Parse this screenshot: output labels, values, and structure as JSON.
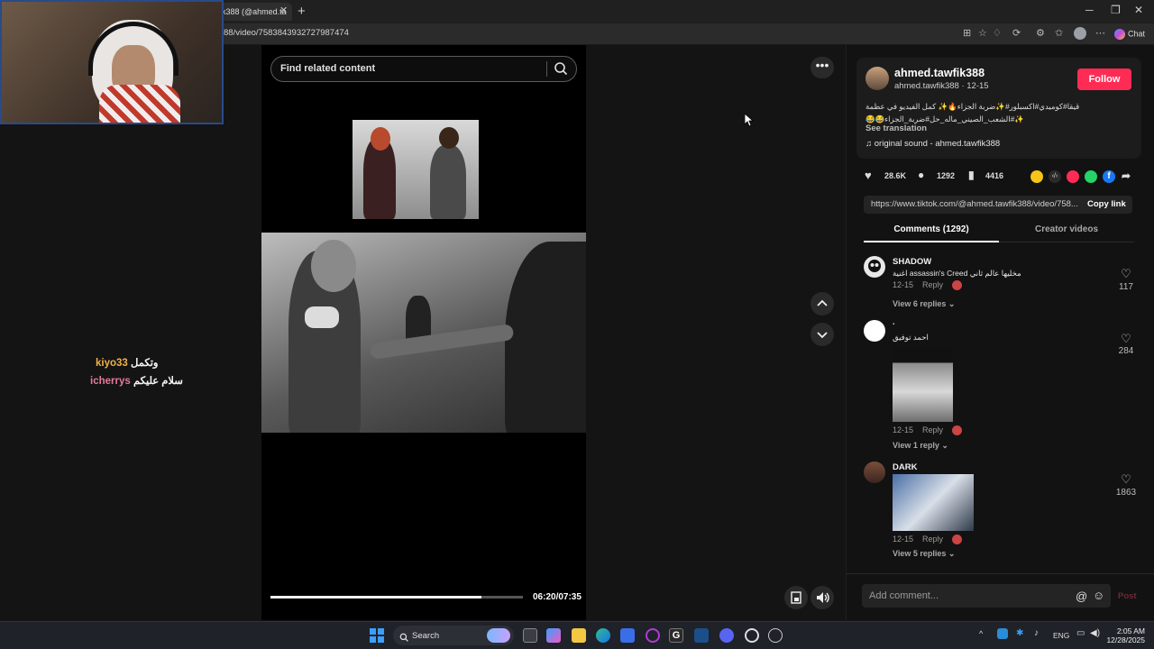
{
  "browser": {
    "tab_title": "k388 (@ahmed.ta",
    "url": "88/video/7583843932727987474",
    "chat_label": "Chat"
  },
  "stream_chat": [
    {
      "user": "kiyo33",
      "message": "وتكمل"
    },
    {
      "user": "icherrys",
      "message": "سلام عليكم"
    }
  ],
  "video": {
    "search_placeholder": "Find related content",
    "time": "06:20/07:35",
    "progress_fraction": 0.836
  },
  "author": {
    "name": "ahmed.tawfik388",
    "sub": "ahmed.tawfik388 · 12-15",
    "follow_label": "Follow",
    "description_line1": "قيقا#كوميدي#اكسبلور#✨ضربة الجزاء🔥✨ كمل الفيديو في عظمة",
    "description_line2": "✨#الشعب_الصيني_ماله_حل#ضربة_الجزاء😂😂",
    "see_translation": "See translation",
    "sound": "original sound - ahmed.tawfik388"
  },
  "stats": {
    "likes": "28.6K",
    "comments": "1292",
    "saves": "4416"
  },
  "share": {
    "link": "https://www.tiktok.com/@ahmed.tawfik388/video/758...",
    "copy_label": "Copy link"
  },
  "tabs": {
    "comments": "Comments (1292)",
    "creator": "Creator videos"
  },
  "comments": [
    {
      "name": "SHADOW",
      "text": "اغنية assassin's Creed مخليها عالم ثاني",
      "date": "12-15",
      "reply": "Reply",
      "likes": "117",
      "view": "View 6 replies ⌄"
    },
    {
      "name": ".",
      "text": "احمد توفيق",
      "date": "12-15",
      "reply": "Reply",
      "likes": "284",
      "view": "View 1 reply ⌄"
    },
    {
      "name": "DARK",
      "text": "",
      "date": "12-15",
      "reply": "Reply",
      "likes": "1863",
      "view": "View 5 replies ⌄"
    }
  ],
  "comment_input": {
    "placeholder": "Add comment...",
    "post_label": "Post"
  },
  "taskbar": {
    "search_label": "Search",
    "lang": "ENG",
    "time": "2:05 AM",
    "date": "12/28/2025"
  },
  "colors": {
    "follow": "#fe2c55",
    "background": "#121212"
  }
}
